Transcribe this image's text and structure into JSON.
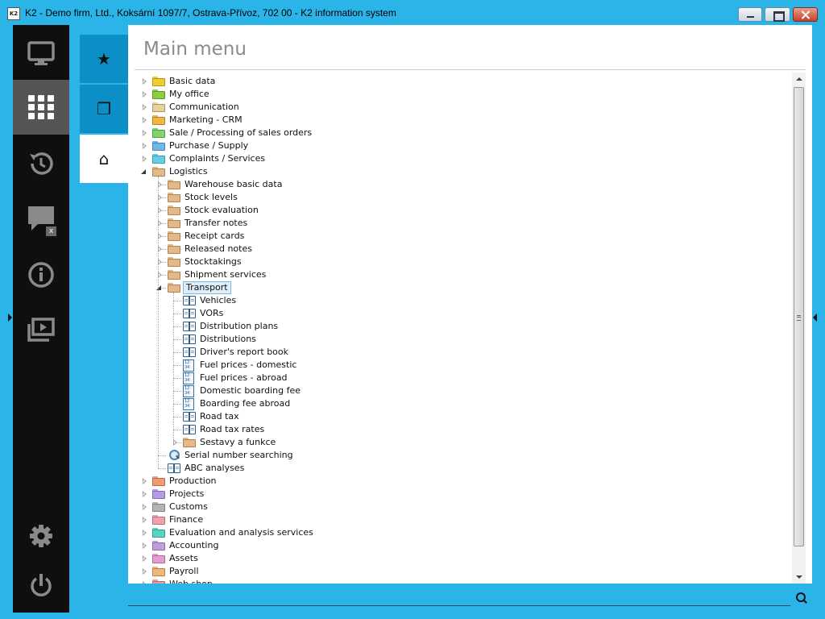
{
  "window": {
    "app_icon_text": "K2",
    "title": "K2 - Demo firm, Ltd., Koksární 1097/7, Ostrava-Přívoz, 702 00 - K2 information system"
  },
  "rail": [
    {
      "name": "desktop",
      "icon": "monitor-icon",
      "active": false
    },
    {
      "name": "main-menu",
      "icon": "grid-icon",
      "active": true
    },
    {
      "name": "history",
      "icon": "history-icon",
      "active": false
    },
    {
      "name": "messages",
      "icon": "chat-icon",
      "active": false,
      "badge": "x"
    },
    {
      "name": "info",
      "icon": "info-icon",
      "active": false
    },
    {
      "name": "media",
      "icon": "play-stack-icon",
      "active": false
    },
    {
      "name": "settings",
      "icon": "gear-icon",
      "active": false
    },
    {
      "name": "power",
      "icon": "power-icon",
      "active": false
    }
  ],
  "panel_tabs": [
    {
      "name": "favorites",
      "icon": "star-icon",
      "glyph": "★",
      "active": false
    },
    {
      "name": "windows",
      "icon": "windows-icon",
      "glyph": "❐",
      "active": false
    },
    {
      "name": "home",
      "icon": "home-icon",
      "glyph": "⌂",
      "active": true
    }
  ],
  "main": {
    "title": "Main menu"
  },
  "tree": [
    {
      "label": "Basic data",
      "level": 0,
      "kind": "folder",
      "color": "#f2cd2b",
      "state": "closed"
    },
    {
      "label": "My office",
      "level": 0,
      "kind": "folder",
      "color": "#8ccf3c",
      "state": "closed"
    },
    {
      "label": "Communication",
      "level": 0,
      "kind": "folder",
      "color": "#e8d29c",
      "state": "closed"
    },
    {
      "label": "Marketing - CRM",
      "level": 0,
      "kind": "folder",
      "color": "#f2b642",
      "state": "closed"
    },
    {
      "label": "Sale / Processing of sales orders",
      "level": 0,
      "kind": "folder",
      "color": "#7fd46a",
      "state": "closed"
    },
    {
      "label": "Purchase / Supply",
      "level": 0,
      "kind": "folder",
      "color": "#6fb6ea",
      "state": "closed"
    },
    {
      "label": "Complaints / Services",
      "level": 0,
      "kind": "folder",
      "color": "#63cfe8",
      "state": "closed"
    },
    {
      "label": "Logistics",
      "level": 0,
      "kind": "folder",
      "color": "#e7b886",
      "state": "open"
    },
    {
      "label": "Warehouse basic data",
      "level": 1,
      "kind": "folder",
      "color": "#e7b886",
      "state": "closed"
    },
    {
      "label": "Stock levels",
      "level": 1,
      "kind": "folder",
      "color": "#e7b886",
      "state": "closed"
    },
    {
      "label": "Stock evaluation",
      "level": 1,
      "kind": "folder",
      "color": "#e7b886",
      "state": "closed"
    },
    {
      "label": "Transfer notes",
      "level": 1,
      "kind": "folder",
      "color": "#e7b886",
      "state": "closed"
    },
    {
      "label": "Receipt cards",
      "level": 1,
      "kind": "folder",
      "color": "#e7b886",
      "state": "closed"
    },
    {
      "label": "Released notes",
      "level": 1,
      "kind": "folder",
      "color": "#e7b886",
      "state": "closed"
    },
    {
      "label": "Stocktakings",
      "level": 1,
      "kind": "folder",
      "color": "#e7b886",
      "state": "closed"
    },
    {
      "label": "Shipment services",
      "level": 1,
      "kind": "folder",
      "color": "#e7b886",
      "state": "closed"
    },
    {
      "label": "Transport",
      "level": 1,
      "kind": "folder",
      "color": "#e7b886",
      "state": "open",
      "selected": true
    },
    {
      "label": "Vehicles",
      "level": 2,
      "kind": "book",
      "state": "leaf"
    },
    {
      "label": "VORs",
      "level": 2,
      "kind": "book",
      "state": "leaf"
    },
    {
      "label": "Distribution plans",
      "level": 2,
      "kind": "book",
      "state": "leaf"
    },
    {
      "label": "Distributions",
      "level": 2,
      "kind": "book",
      "state": "leaf"
    },
    {
      "label": "Driver's report book",
      "level": 2,
      "kind": "book",
      "state": "leaf"
    },
    {
      "label": "Fuel prices - domestic",
      "level": 2,
      "kind": "sheet",
      "state": "leaf"
    },
    {
      "label": "Fuel prices - abroad",
      "level": 2,
      "kind": "sheet",
      "state": "leaf"
    },
    {
      "label": "Domestic boarding fee",
      "level": 2,
      "kind": "sheet",
      "state": "leaf"
    },
    {
      "label": "Boarding fee abroad",
      "level": 2,
      "kind": "sheet",
      "state": "leaf"
    },
    {
      "label": "Road tax",
      "level": 2,
      "kind": "book",
      "state": "leaf"
    },
    {
      "label": "Road tax rates",
      "level": 2,
      "kind": "book",
      "state": "leaf"
    },
    {
      "label": "Sestavy a funkce",
      "level": 2,
      "kind": "folder",
      "color": "#e7b886",
      "state": "closed"
    },
    {
      "label": "Serial number searching",
      "level": 1,
      "kind": "magnifier",
      "state": "leaf"
    },
    {
      "label": "ABC analyses",
      "level": 1,
      "kind": "book",
      "state": "leaf"
    },
    {
      "label": "Production",
      "level": 0,
      "kind": "folder",
      "color": "#f49b6e",
      "state": "closed"
    },
    {
      "label": "Projects",
      "level": 0,
      "kind": "folder",
      "color": "#b59be6",
      "state": "closed"
    },
    {
      "label": "Customs",
      "level": 0,
      "kind": "folder",
      "color": "#b4b4b4",
      "state": "closed"
    },
    {
      "label": "Finance",
      "level": 0,
      "kind": "folder",
      "color": "#f3a0ae",
      "state": "closed"
    },
    {
      "label": "Evaluation and analysis services",
      "level": 0,
      "kind": "folder",
      "color": "#57d6c8",
      "state": "closed"
    },
    {
      "label": "Accounting",
      "level": 0,
      "kind": "folder",
      "color": "#c39be0",
      "state": "closed"
    },
    {
      "label": "Assets",
      "level": 0,
      "kind": "folder",
      "color": "#e79bd3",
      "state": "closed"
    },
    {
      "label": "Payroll",
      "level": 0,
      "kind": "folder",
      "color": "#f3b777",
      "state": "closed"
    },
    {
      "label": "Web shop",
      "level": 0,
      "kind": "folder",
      "color": "#f09a9a",
      "state": "closed"
    }
  ],
  "search": {
    "value": "",
    "placeholder": ""
  },
  "colors": {
    "accent": "#2bb4e8",
    "panel_tab": "#0b8fc6",
    "rail": "#0f0f0f",
    "rail_active": "#555555"
  }
}
